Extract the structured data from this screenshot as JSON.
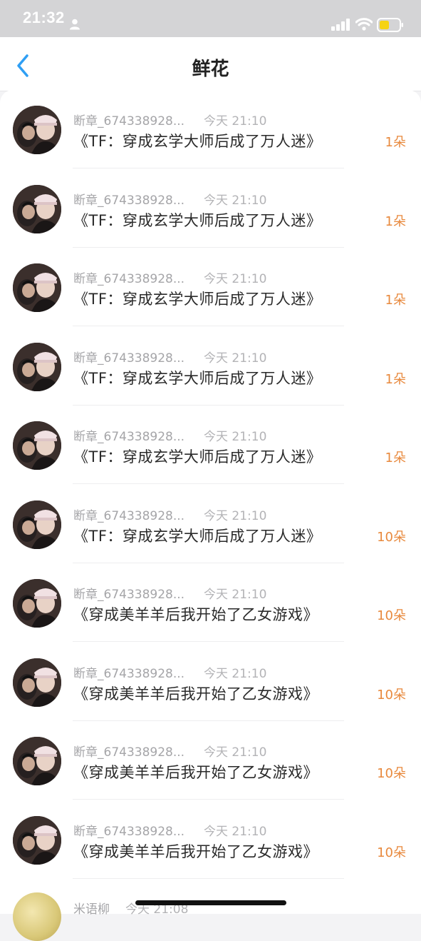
{
  "status_bar": {
    "time": "21:32",
    "battery_color": "#f5d313"
  },
  "nav": {
    "title": "鲜花",
    "back_icon": "chevron-left-icon"
  },
  "colors": {
    "accent": "#2f9ff4",
    "count": "#e8893d"
  },
  "items": [
    {
      "user": "断章_674338928...",
      "time": "今天 21:10",
      "book": "《TF：穿成玄学大师后成了万人迷》",
      "count": "1朵"
    },
    {
      "user": "断章_674338928...",
      "time": "今天 21:10",
      "book": "《TF：穿成玄学大师后成了万人迷》",
      "count": "1朵"
    },
    {
      "user": "断章_674338928...",
      "time": "今天 21:10",
      "book": "《TF：穿成玄学大师后成了万人迷》",
      "count": "1朵"
    },
    {
      "user": "断章_674338928...",
      "time": "今天 21:10",
      "book": "《TF：穿成玄学大师后成了万人迷》",
      "count": "1朵"
    },
    {
      "user": "断章_674338928...",
      "time": "今天 21:10",
      "book": "《TF：穿成玄学大师后成了万人迷》",
      "count": "1朵"
    },
    {
      "user": "断章_674338928...",
      "time": "今天 21:10",
      "book": "《TF：穿成玄学大师后成了万人迷》",
      "count": "10朵"
    },
    {
      "user": "断章_674338928...",
      "time": "今天 21:10",
      "book": "《穿成美羊羊后我开始了乙女游戏》",
      "count": "10朵"
    },
    {
      "user": "断章_674338928...",
      "time": "今天 21:10",
      "book": "《穿成美羊羊后我开始了乙女游戏》",
      "count": "10朵"
    },
    {
      "user": "断章_674338928...",
      "time": "今天 21:10",
      "book": "《穿成美羊羊后我开始了乙女游戏》",
      "count": "10朵"
    },
    {
      "user": "断章_674338928...",
      "time": "今天 21:10",
      "book": "《穿成美羊羊后我开始了乙女游戏》",
      "count": "10朵"
    }
  ],
  "partial_item": {
    "user": "米语柳",
    "time": "今天 21:08"
  }
}
